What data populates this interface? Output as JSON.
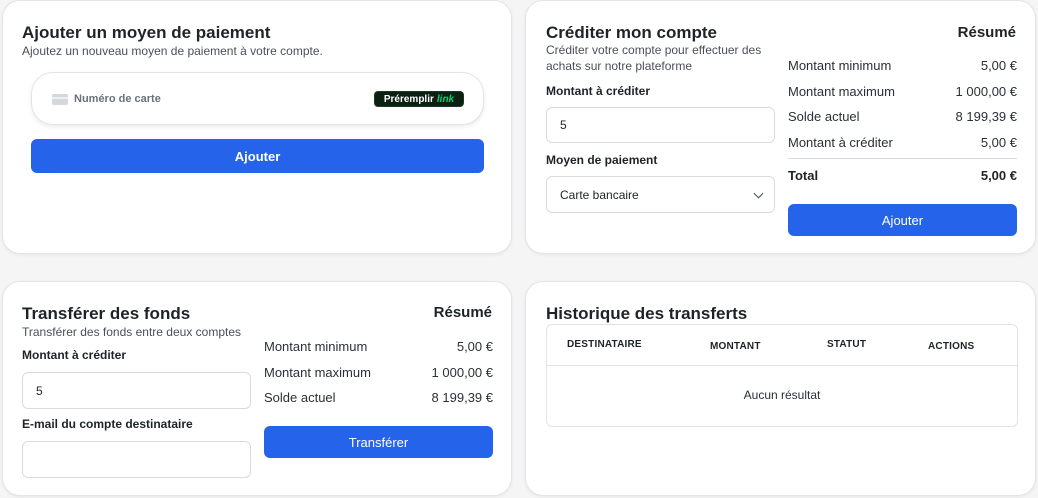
{
  "add_payment": {
    "title": "Ajouter un moyen de paiement",
    "subtitle": "Ajoutez un nouveau moyen de paiement à votre compte.",
    "card_placeholder": "Numéro de carte",
    "prefill_label": "Préremplir",
    "prefill_brand": "link",
    "submit_label": "Ajouter"
  },
  "credit_account": {
    "title": "Créditer mon compte",
    "subtitle": "Créditer votre compte pour effectuer des achats sur notre plateforme",
    "amount_label": "Montant à créditer",
    "amount_value": "5",
    "method_label": "Moyen de paiement",
    "method_value": "Carte bancaire",
    "summary": {
      "title": "Résumé",
      "rows": [
        {
          "label": "Montant minimum",
          "value": "5,00 €"
        },
        {
          "label": "Montant maximum",
          "value": "1 000,00 €"
        },
        {
          "label": "Solde actuel",
          "value": "8 199,39 €"
        },
        {
          "label": "Montant à créditer",
          "value": "5,00 €"
        }
      ],
      "total_label": "Total",
      "total_value": "5,00 €",
      "submit_label": "Ajouter"
    }
  },
  "transfer": {
    "title": "Transférer des fonds",
    "subtitle": "Transférer des fonds entre deux comptes",
    "amount_label": "Montant à créditer",
    "amount_value": "5",
    "email_label": "E-mail du compte destinataire",
    "email_value": "",
    "summary": {
      "title": "Résumé",
      "rows": [
        {
          "label": "Montant minimum",
          "value": "5,00 €"
        },
        {
          "label": "Montant maximum",
          "value": "1 000,00 €"
        },
        {
          "label": "Solde actuel",
          "value": "8 199,39 €"
        }
      ],
      "submit_label": "Transférer"
    }
  },
  "history": {
    "title": "Historique des transferts",
    "columns": [
      "DESTINATAIRE",
      "MONTANT",
      "STATUT",
      "ACTIONS"
    ],
    "empty_text": "Aucun résultat"
  },
  "colors": {
    "accent": "#2563eb",
    "link_green": "#00d66f"
  },
  "icons": {
    "card": "credit-card-icon",
    "select": "chevron-down-icon"
  }
}
